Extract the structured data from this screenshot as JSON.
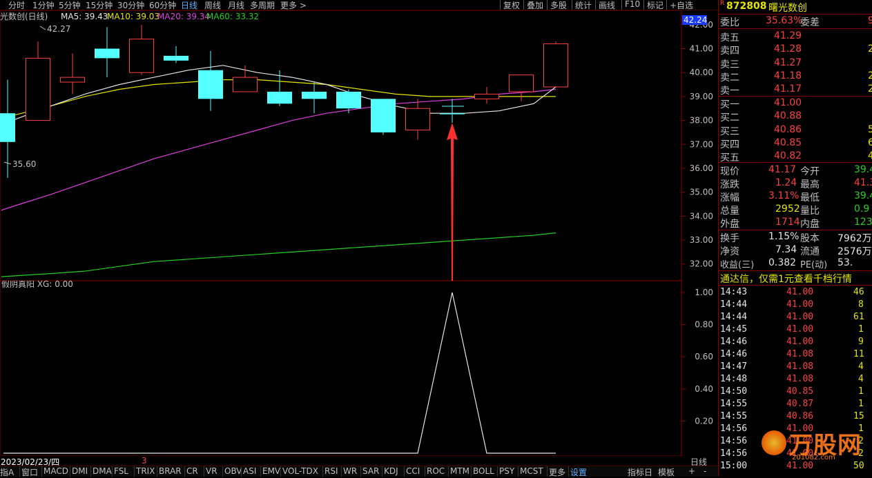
{
  "toolbar": {
    "period_tabs": [
      "分时",
      "1分钟",
      "5分钟",
      "15分钟",
      "30分钟",
      "60分钟",
      "日线",
      "周线",
      "月线",
      "多周期",
      "更多 >"
    ],
    "active_tab": "日线",
    "right_buttons": [
      "复权",
      "叠加",
      "多股",
      "统计",
      "画线",
      "F10",
      "标记",
      "+自选"
    ]
  },
  "chart": {
    "title": "光数创(日线)",
    "ma_legend": [
      {
        "label": "MA5: 39.43",
        "color": "#e6e6e6"
      },
      {
        "label": "MA10: 39.03",
        "color": "#e6e600"
      },
      {
        "label": "MA20: 39.34",
        "color": "#e040e0"
      },
      {
        "label": "MA60: 33.32",
        "color": "#22d022"
      }
    ],
    "high_marker": "42.27",
    "low_marker": "35.60",
    "current_price_tag": "42.24",
    "price_axis": [
      "42.00",
      "41.00",
      "40.00",
      "39.00",
      "38.00",
      "37.00",
      "36.00",
      "35.00",
      "34.00",
      "33.00",
      "32.00"
    ],
    "indicator_title": "假阴真阳 XG: 0.00",
    "indicator_axis": [
      "1.00",
      "0.80",
      "0.60",
      "0.40",
      "0.20"
    ],
    "date_label": "2023/02/23/四",
    "date_mark": "3",
    "period_label": "日线"
  },
  "chart_data": {
    "type": "candlestick",
    "title": "光数创(日线)",
    "ylim": [
      31.3,
      42.6
    ],
    "candles": [
      {
        "open": 37.1,
        "close": 38.3,
        "high": 39.7,
        "low": 35.6,
        "color": "cyan"
      },
      {
        "open": 38.0,
        "close": 40.6,
        "high": 41.3,
        "low": 38.0,
        "color": "red"
      },
      {
        "open": 39.6,
        "close": 39.8,
        "high": 40.8,
        "low": 39.1,
        "color": "red"
      },
      {
        "open": 41.0,
        "close": 40.6,
        "high": 41.9,
        "low": 39.8,
        "color": "cyan"
      },
      {
        "open": 40.0,
        "close": 41.4,
        "high": 42.0,
        "low": 39.9,
        "color": "red"
      },
      {
        "open": 40.7,
        "close": 40.5,
        "high": 41.1,
        "low": 40.4,
        "color": "cyan"
      },
      {
        "open": 40.1,
        "close": 38.9,
        "high": 40.9,
        "low": 38.4,
        "color": "cyan"
      },
      {
        "open": 39.2,
        "close": 39.8,
        "high": 40.3,
        "low": 39.2,
        "color": "red"
      },
      {
        "open": 39.2,
        "close": 38.7,
        "high": 40.1,
        "low": 38.6,
        "color": "cyan"
      },
      {
        "open": 39.2,
        "close": 38.9,
        "high": 39.6,
        "low": 38.3,
        "color": "cyan"
      },
      {
        "open": 39.2,
        "close": 38.5,
        "high": 39.3,
        "low": 38.3,
        "color": "cyan"
      },
      {
        "open": 38.9,
        "close": 37.5,
        "high": 38.9,
        "low": 37.4,
        "color": "cyan"
      },
      {
        "open": 37.6,
        "close": 38.5,
        "high": 38.9,
        "low": 37.2,
        "color": "red"
      },
      {
        "open": 38.3,
        "close": 38.3,
        "high": 38.9,
        "low": 37.9,
        "color": "cyan"
      },
      {
        "open": 38.9,
        "close": 39.1,
        "high": 39.4,
        "low": 38.7,
        "color": "red"
      },
      {
        "open": 39.2,
        "close": 39.9,
        "high": 39.9,
        "low": 38.8,
        "color": "red"
      },
      {
        "open": 39.4,
        "close": 41.2,
        "high": 41.3,
        "low": 39.4,
        "color": "red"
      }
    ],
    "ma5": [
      38.0,
      38.6,
      39.1,
      39.5,
      39.8,
      40.1,
      40.3,
      40.0,
      39.8,
      39.5,
      39.0,
      38.6,
      38.3,
      38.3,
      38.4,
      38.7,
      39.4
    ],
    "ma10": [
      38.2,
      38.6,
      39.0,
      39.3,
      39.5,
      39.6,
      39.7,
      39.7,
      39.6,
      39.5,
      39.3,
      39.1,
      39.0,
      39.0,
      39.0,
      39.0,
      39.0
    ],
    "ma20": [
      34.4,
      34.9,
      35.4,
      35.9,
      36.4,
      36.8,
      37.2,
      37.6,
      38.0,
      38.3,
      38.5,
      38.7,
      38.8,
      38.9,
      39.1,
      39.2,
      39.3
    ],
    "ma60": [
      31.5,
      31.6,
      31.7,
      31.9,
      32.1,
      32.2,
      32.3,
      32.4,
      32.5,
      32.6,
      32.7,
      32.8,
      32.9,
      33.0,
      33.1,
      33.2,
      33.3
    ],
    "indicator": {
      "name": "XG",
      "values": [
        0,
        0,
        0,
        0,
        0,
        0,
        0,
        0,
        0,
        0,
        0,
        0,
        0,
        1,
        0,
        0,
        0
      ],
      "ylim": [
        0,
        1.05
      ]
    }
  },
  "quote": {
    "flag": "R",
    "code": "872808",
    "name": "曙光数创",
    "weibi_label": "委比",
    "weibi_value": "35.63%",
    "weicha_label": "委差",
    "weicha_value": "9",
    "asks": [
      {
        "label": "卖五",
        "price": "41.29",
        "vol": ""
      },
      {
        "label": "卖四",
        "price": "41.28",
        "vol": "2"
      },
      {
        "label": "卖三",
        "price": "41.27",
        "vol": ""
      },
      {
        "label": "卖二",
        "price": "41.18",
        "vol": "2"
      },
      {
        "label": "卖一",
        "price": "41.17",
        "vol": "2"
      }
    ],
    "bids": [
      {
        "label": "买一",
        "price": "41.00",
        "vol": ""
      },
      {
        "label": "买二",
        "price": "40.88",
        "vol": ""
      },
      {
        "label": "买三",
        "price": "40.86",
        "vol": "5"
      },
      {
        "label": "买四",
        "price": "40.85",
        "vol": "6"
      },
      {
        "label": "买五",
        "price": "40.82",
        "vol": "4"
      }
    ],
    "stats": [
      {
        "l1": "现价",
        "v1": "41.17",
        "c1": "red",
        "l2": "今开",
        "v2": "39.4",
        "c2": "green"
      },
      {
        "l1": "涨跌",
        "v1": "1.24",
        "c1": "red",
        "l2": "最高",
        "v2": "41.3",
        "c2": "red"
      },
      {
        "l1": "涨幅",
        "v1": "3.11%",
        "c1": "red",
        "l2": "最低",
        "v2": "39.4",
        "c2": "green"
      },
      {
        "l1": "总量",
        "v1": "2952",
        "c1": "yellow",
        "l2": "量比",
        "v2": "0.9",
        "c2": "green"
      },
      {
        "l1": "外盘",
        "v1": "1714",
        "c1": "red",
        "l2": "内盘",
        "v2": "123",
        "c2": "green"
      }
    ],
    "stats2": [
      {
        "l1": "换手",
        "v1": "1.15%",
        "l2": "股本",
        "v2": "7962万"
      },
      {
        "l1": "净资",
        "v1": "7.34",
        "l2": "流通",
        "v2": "2576万"
      },
      {
        "l1": "收益(三)",
        "v1": "0.382",
        "l2": "PE(动)",
        "v2": "53."
      }
    ],
    "banner": "通达信，仅需1元查看千档行情",
    "ticks": [
      {
        "t": "14:43",
        "p": "41.00",
        "v": "46",
        "vc": "yellow"
      },
      {
        "t": "14:44",
        "p": "41.00",
        "v": "8",
        "vc": "yellow"
      },
      {
        "t": "14:44",
        "p": "41.00",
        "v": "61",
        "vc": "yellow"
      },
      {
        "t": "14:45",
        "p": "41.00",
        "v": "1",
        "vc": "yellow"
      },
      {
        "t": "14:46",
        "p": "41.00",
        "v": "9",
        "vc": "yellow"
      },
      {
        "t": "14:46",
        "p": "41.08",
        "v": "11",
        "vc": "yellow"
      },
      {
        "t": "14:47",
        "p": "41.08",
        "v": "4",
        "vc": "yellow"
      },
      {
        "t": "14:48",
        "p": "41.08",
        "v": "4",
        "vc": "yellow"
      },
      {
        "t": "14:50",
        "p": "40.85",
        "v": "1",
        "vc": "yellow"
      },
      {
        "t": "14:55",
        "p": "40.87",
        "v": "1",
        "vc": "yellow"
      },
      {
        "t": "14:55",
        "p": "40.86",
        "v": "15",
        "vc": "yellow"
      },
      {
        "t": "14:56",
        "p": "41.00",
        "v": "1",
        "vc": "yellow"
      },
      {
        "t": "14:56",
        "p": "41.00",
        "v": "2",
        "vc": "yellow"
      },
      {
        "t": "14:56",
        "p": "41.00",
        "v": "2",
        "vc": "yellow"
      },
      {
        "t": "15:00",
        "p": "41.00",
        "v": "50",
        "vc": "yellow"
      }
    ],
    "watermark": "万股网",
    "watermark_url": "201082.com"
  },
  "bottombar": {
    "tabs": [
      "指A",
      "窗口",
      "MACD",
      "DMI",
      "DMA",
      "FSL",
      "TRIX",
      "BRAR",
      "CR",
      "VR",
      "OBV",
      "ASI",
      "EMV",
      "VOL-TDX",
      "RSI",
      "WR",
      "SAR",
      "KDJ",
      "CCI",
      "ROC",
      "MTM",
      "BOLL",
      "PSY",
      "MCST",
      "更多",
      "设置"
    ],
    "right": [
      "指标日",
      "模板",
      "+",
      "-"
    ]
  }
}
